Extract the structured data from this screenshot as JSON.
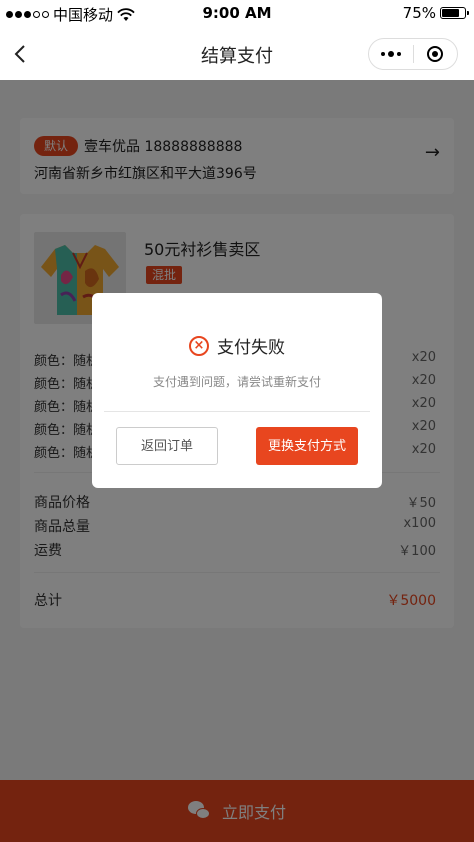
{
  "status_bar": {
    "carrier": "中国移动",
    "time": "9:00 AM",
    "battery": "75%",
    "battery_level": 0.75
  },
  "nav": {
    "back_icon": "chevron-left-icon",
    "title": "结算支付",
    "more_icon": "more-dots-icon",
    "close_icon": "target-icon"
  },
  "address": {
    "default_tag": "默认",
    "name_phone": "壹车优品  18888888888",
    "detail": "河南省新乡市红旗区和平大道396号"
  },
  "product": {
    "title": "50元衬衫售卖区",
    "tag": "混批"
  },
  "variants": [
    {
      "label": "颜色：随机",
      "qty": "x20"
    },
    {
      "label": "颜色：随机",
      "qty": "x20"
    },
    {
      "label": "颜色：随机",
      "qty": "x20"
    },
    {
      "label": "颜色：随机",
      "qty": "x20"
    },
    {
      "label": "颜色：随机",
      "qty": "x20"
    }
  ],
  "summary": {
    "price_label": "商品价格",
    "price_value": "￥50",
    "count_label": "商品总量",
    "count_value": "x100",
    "shipping_label": "运费",
    "shipping_value": "￥100",
    "total_label": "总计",
    "total_value": "￥5000"
  },
  "pay_button": "立即支付",
  "modal": {
    "title": "支付失败",
    "message": "支付遇到问题，请尝试重新支付",
    "back_button": "返回订单",
    "change_button": "更换支付方式"
  },
  "colors": {
    "accent": "#e8461f"
  }
}
